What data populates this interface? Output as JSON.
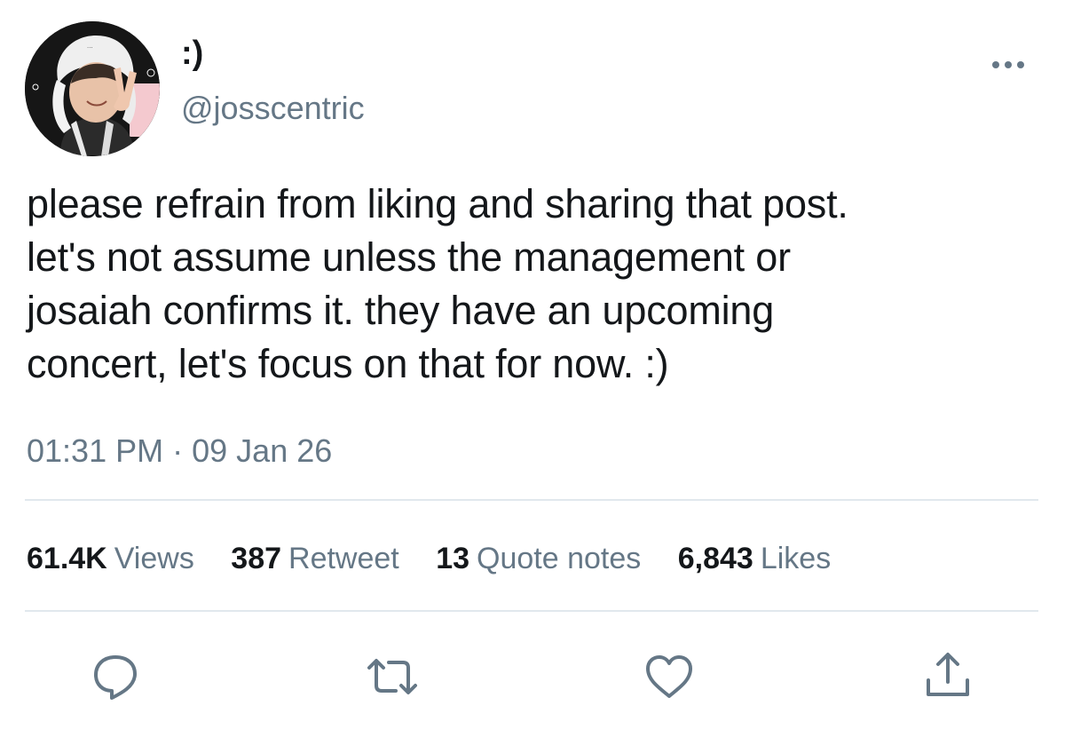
{
  "author": {
    "display_name": ":)",
    "handle": "@josscentric"
  },
  "tweet": {
    "text": "please refrain from liking and sharing that post.\nlet's not assume unless the management or\njosaiah confirms it. they have an upcoming\nconcert, let's focus on that for now.  :)",
    "time": "01:31 PM",
    "separator": "·",
    "date": "09 Jan 26"
  },
  "stats": {
    "views": {
      "count": "61.4K",
      "label": "Views"
    },
    "retweets": {
      "count": "387",
      "label": "Retweet"
    },
    "quotes": {
      "count": "13",
      "label": "Quote notes"
    },
    "likes": {
      "count": "6,843",
      "label": "Likes"
    }
  },
  "icons": {
    "more": "more-dots-icon",
    "reply": "reply-icon",
    "retweet": "retweet-icon",
    "like": "heart-icon",
    "share": "share-icon"
  },
  "colors": {
    "text_primary": "#14171a",
    "text_secondary": "#657786",
    "divider": "#e1e8ed",
    "icon": "#657786"
  }
}
